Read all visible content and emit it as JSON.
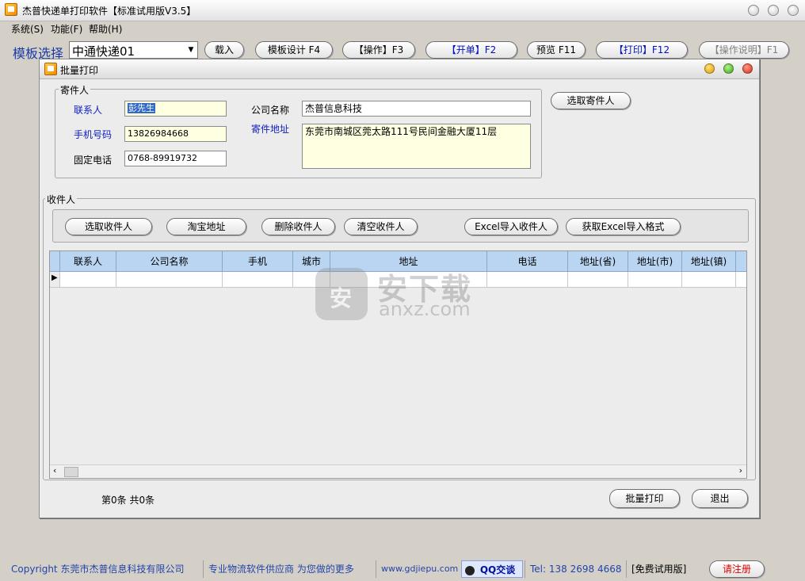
{
  "app": {
    "title": "杰普快递单打印软件【标准试用版V3.5】"
  },
  "menu": {
    "items": [
      {
        "label": "系统(S)"
      },
      {
        "label": "功能(F)"
      },
      {
        "label": "帮助(H)"
      }
    ]
  },
  "toolbar": {
    "template_label": "模板选择",
    "template_value": "中通快递01",
    "buttons": [
      {
        "label": "载入"
      },
      {
        "label": "模板设计 F4"
      },
      {
        "label": "【操作】F3"
      },
      {
        "label": "【开单】F2"
      },
      {
        "label": "预览 F11"
      },
      {
        "label": "【打印】F12"
      },
      {
        "label": "【操作说明】F1"
      }
    ]
  },
  "dialog": {
    "title": "批量打印",
    "sender": {
      "group_title": "寄件人",
      "contact_label": "联系人",
      "contact_value": "彭先生",
      "mobile_label": "手机号码",
      "mobile_value": "13826984668",
      "phone_label": "固定电话",
      "phone_value": "0768-89919732",
      "company_label": "公司名称",
      "company_value": "杰普信息科技",
      "address_label": "寄件地址",
      "address_value": "东莞市南城区莞太路111号民间金融大厦11层",
      "select_button": "选取寄件人"
    },
    "receiver": {
      "group_title": "收件人",
      "buttons": [
        {
          "label": "选取收件人"
        },
        {
          "label": "淘宝地址"
        },
        {
          "label": "删除收件人"
        },
        {
          "label": "清空收件人"
        },
        {
          "label": "Excel导入收件人"
        },
        {
          "label": "获取Excel导入格式"
        }
      ],
      "columns": [
        "联系人",
        "公司名称",
        "手机",
        "城市",
        "地址",
        "电话",
        "地址(省)",
        "地址(市)",
        "地址(镇)"
      ]
    },
    "page_info": "第0条 共0条",
    "batch_print_button": "批量打印",
    "exit_button": "退出"
  },
  "watermark": {
    "cn": "安下载",
    "en": "anxz.com"
  },
  "statusbar": {
    "copyright": "Copyright 东莞市杰普信息科技有限公司",
    "slogan": "专业物流软件供应商  为您做的更多",
    "website": "www.gdjiepu.com",
    "qq": "QQ交谈",
    "tel": "Tel: 138 2698 4668",
    "edition": "[免费试用版]",
    "register": "请注册"
  },
  "colors": {
    "accent_blue": "#1020c0",
    "header_blue": "#b9d5f2",
    "register_red": "#e00000"
  }
}
